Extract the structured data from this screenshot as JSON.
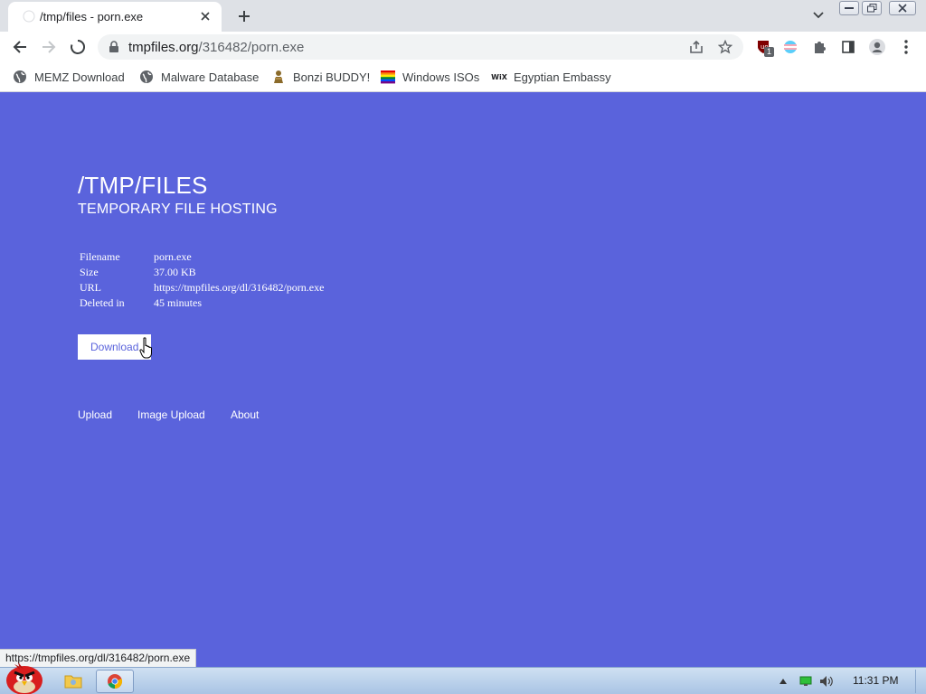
{
  "browser": {
    "tab": {
      "title": "/tmp/files - porn.exe"
    },
    "address_bar": {
      "host": "tmpfiles.org",
      "path": "/316482/porn.exe"
    },
    "extension_badge": "1",
    "bookmarks": [
      {
        "label": "MEMZ Download",
        "icon": "globe-icon"
      },
      {
        "label": "Malware Database",
        "icon": "globe-icon"
      },
      {
        "label": "Bonzi BUDDY!",
        "icon": "bonzi-icon"
      },
      {
        "label": "Windows ISOs",
        "icon": "rainbow-flag-icon"
      },
      {
        "label": "Egyptian Embassy",
        "icon": "wix-icon",
        "icon_text": "WiX"
      }
    ]
  },
  "page": {
    "title": "/TMP/FILES",
    "subtitle": "TEMPORARY FILE HOSTING",
    "file_info": [
      {
        "label": "Filename",
        "value": "porn.exe"
      },
      {
        "label": "Size",
        "value": "37.00 KB"
      },
      {
        "label": "URL",
        "value": "https://tmpfiles.org/dl/316482/porn.exe"
      },
      {
        "label": "Deleted in",
        "value": "45 minutes"
      }
    ],
    "download_label": "Download",
    "footer_links": [
      "Upload",
      "Image Upload",
      "About"
    ]
  },
  "status_url": "https://tmpfiles.org/dl/316482/porn.exe",
  "taskbar": {
    "clock": "11:31 PM"
  },
  "colors": {
    "page_background": "#5a63dc",
    "button_text": "#5a63dc",
    "chrome_frame": "#dee1e6"
  }
}
